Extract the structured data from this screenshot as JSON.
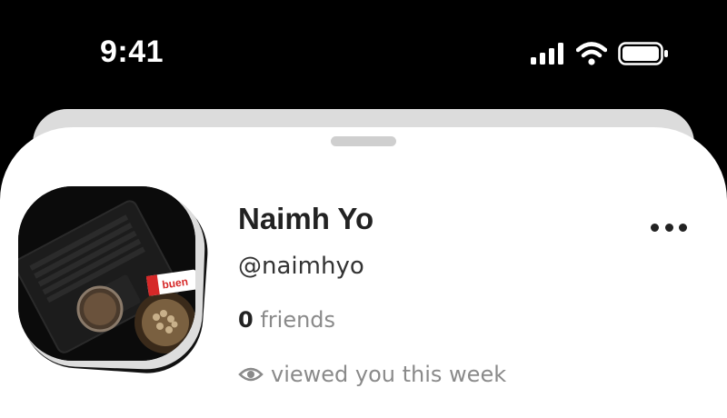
{
  "status_bar": {
    "time": "9:41",
    "icons": [
      "cellular-signal-icon",
      "wifi-icon",
      "battery-icon"
    ]
  },
  "profile": {
    "name": "Naimh Yo",
    "handle": "@naimhyo",
    "friends_count": "0",
    "friends_label": "friends",
    "viewed_label": "viewed you this week",
    "avatar_label": "buen"
  },
  "colors": {
    "background": "#000000",
    "sheet": "#ffffff",
    "text_primary": "#222222",
    "text_secondary": "#8a8a8a"
  }
}
